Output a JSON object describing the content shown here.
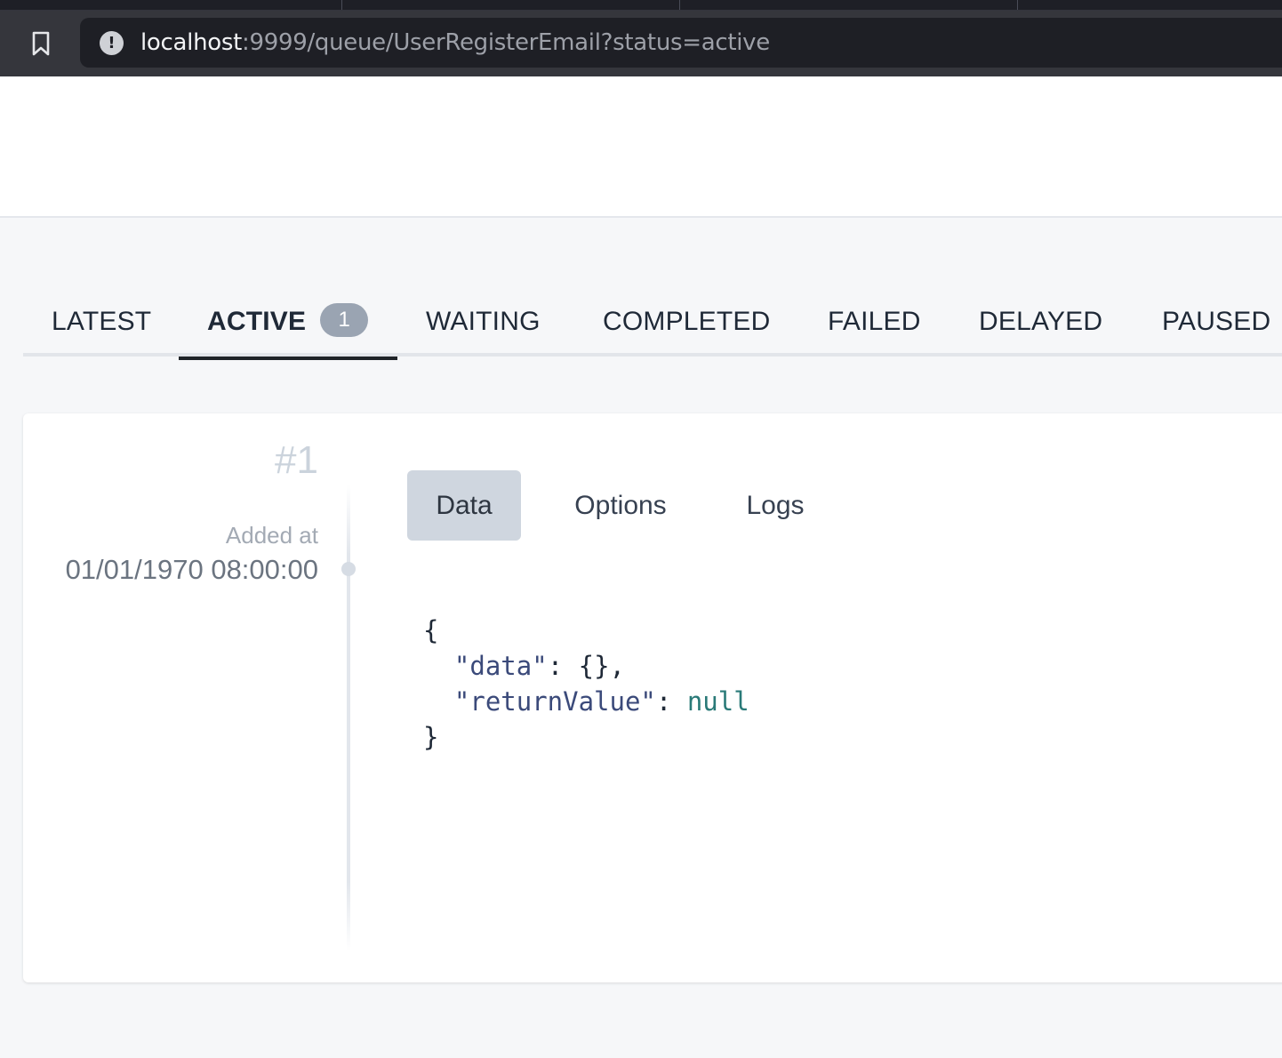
{
  "browser": {
    "url_host": "localhost",
    "url_rest": ":9999/queue/UserRegisterEmail?status=active"
  },
  "status_tabs": [
    {
      "label": "LATEST",
      "active": false
    },
    {
      "label": "ACTIVE",
      "active": true,
      "badge": "1"
    },
    {
      "label": "WAITING",
      "active": false
    },
    {
      "label": "COMPLETED",
      "active": false
    },
    {
      "label": "FAILED",
      "active": false
    },
    {
      "label": "DELAYED",
      "active": false
    },
    {
      "label": "PAUSED",
      "active": false
    }
  ],
  "job": {
    "id": "#1",
    "added_label": "Added at",
    "added_value": "01/01/1970 08:00:00",
    "tabs": [
      {
        "label": "Data",
        "active": true
      },
      {
        "label": "Options",
        "active": false
      },
      {
        "label": "Logs",
        "active": false
      }
    ],
    "code": {
      "open": "{",
      "data_key": "\"data\"",
      "data_sep": ": {},",
      "return_key": "\"returnValue\"",
      "return_sep": ": ",
      "return_value": "null",
      "close": "}"
    }
  },
  "colors": {
    "accent": "#1f2328",
    "badge": "#9aa4b2",
    "active_subtab": "#cfd6df",
    "json_key": "#3b4a7a",
    "json_null": "#2a7a78"
  },
  "icons": {
    "bookmark": "bookmark-icon",
    "info": "info-icon"
  }
}
